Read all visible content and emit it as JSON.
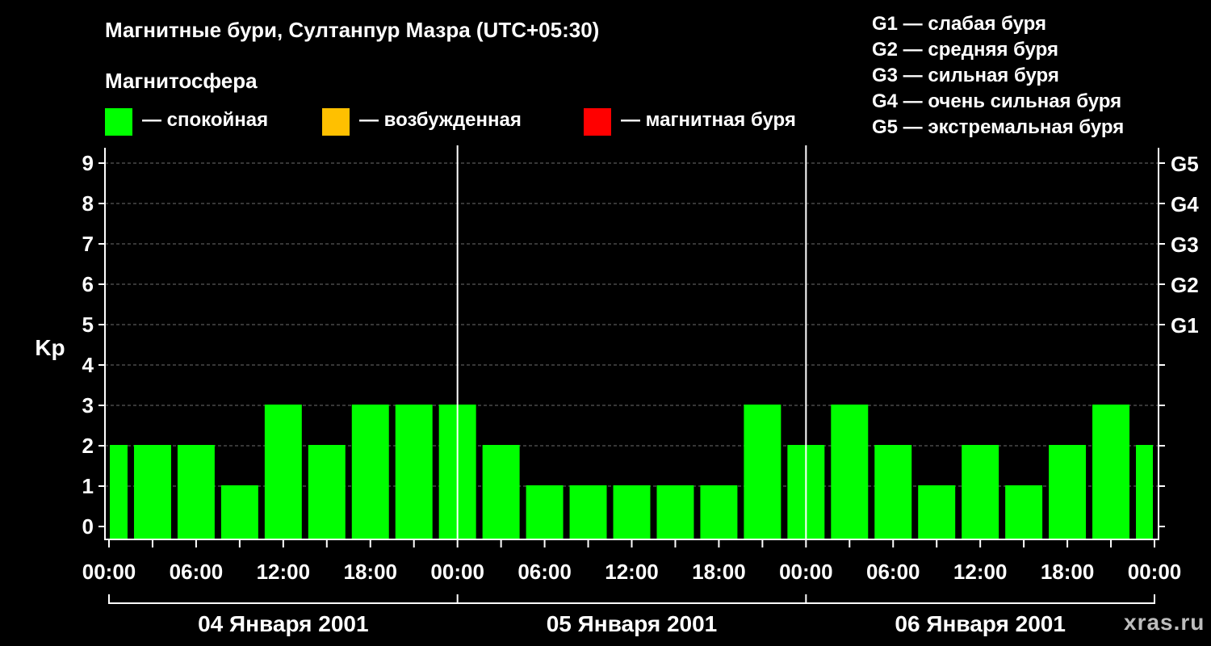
{
  "title": "Магнитные бури, Султанпур Мазра (UTC+05:30)",
  "legend": {
    "title": "Магнитосфера",
    "items": [
      {
        "label": "— спокойная",
        "color": "#00ff00"
      },
      {
        "label": "— возбужденная",
        "color": "#ffc000"
      },
      {
        "label": "— магнитная буря",
        "color": "#ff0000"
      }
    ]
  },
  "g_scale": [
    "G1 — слабая буря",
    "G2 — средняя буря",
    "G3 — сильная буря",
    "G4 — очень сильная буря",
    "G5 — экстремальная буря"
  ],
  "watermark": "xras.ru",
  "chart_data": {
    "type": "bar",
    "ylabel": "Kp",
    "ylim": [
      0,
      9
    ],
    "y_ticks": [
      0,
      1,
      2,
      3,
      4,
      5,
      6,
      7,
      8,
      9
    ],
    "right_axis_labels": [
      {
        "value": 5,
        "label": "G1"
      },
      {
        "value": 6,
        "label": "G2"
      },
      {
        "value": 7,
        "label": "G3"
      },
      {
        "value": 8,
        "label": "G4"
      },
      {
        "value": 9,
        "label": "G5"
      }
    ],
    "x_tick_labels": [
      "00:00",
      "06:00",
      "12:00",
      "18:00",
      "00:00",
      "06:00",
      "12:00",
      "18:00",
      "00:00",
      "06:00",
      "12:00",
      "18:00",
      "00:00"
    ],
    "days": [
      "04 Января 2001",
      "05 Января 2001",
      "06 Января 2001"
    ],
    "x_range_hours": [
      0,
      72
    ],
    "grid": true,
    "bars": [
      {
        "start_hour": 0,
        "end_hour": 1.5,
        "kp": 2,
        "level": "quiet"
      },
      {
        "start_hour": 1.5,
        "end_hour": 4.5,
        "kp": 2,
        "level": "quiet"
      },
      {
        "start_hour": 4.5,
        "end_hour": 7.5,
        "kp": 2,
        "level": "quiet"
      },
      {
        "start_hour": 7.5,
        "end_hour": 10.5,
        "kp": 1,
        "level": "quiet"
      },
      {
        "start_hour": 10.5,
        "end_hour": 13.5,
        "kp": 3,
        "level": "quiet"
      },
      {
        "start_hour": 13.5,
        "end_hour": 16.5,
        "kp": 2,
        "level": "quiet"
      },
      {
        "start_hour": 16.5,
        "end_hour": 19.5,
        "kp": 3,
        "level": "quiet"
      },
      {
        "start_hour": 19.5,
        "end_hour": 22.5,
        "kp": 3,
        "level": "quiet"
      },
      {
        "start_hour": 22.5,
        "end_hour": 25.5,
        "kp": 3,
        "level": "quiet"
      },
      {
        "start_hour": 25.5,
        "end_hour": 28.5,
        "kp": 2,
        "level": "quiet"
      },
      {
        "start_hour": 28.5,
        "end_hour": 31.5,
        "kp": 1,
        "level": "quiet"
      },
      {
        "start_hour": 31.5,
        "end_hour": 34.5,
        "kp": 1,
        "level": "quiet"
      },
      {
        "start_hour": 34.5,
        "end_hour": 37.5,
        "kp": 1,
        "level": "quiet"
      },
      {
        "start_hour": 37.5,
        "end_hour": 40.5,
        "kp": 1,
        "level": "quiet"
      },
      {
        "start_hour": 40.5,
        "end_hour": 43.5,
        "kp": 1,
        "level": "quiet"
      },
      {
        "start_hour": 43.5,
        "end_hour": 46.5,
        "kp": 3,
        "level": "quiet"
      },
      {
        "start_hour": 46.5,
        "end_hour": 49.5,
        "kp": 2,
        "level": "quiet"
      },
      {
        "start_hour": 49.5,
        "end_hour": 52.5,
        "kp": 3,
        "level": "quiet"
      },
      {
        "start_hour": 52.5,
        "end_hour": 55.5,
        "kp": 2,
        "level": "quiet"
      },
      {
        "start_hour": 55.5,
        "end_hour": 58.5,
        "kp": 1,
        "level": "quiet"
      },
      {
        "start_hour": 58.5,
        "end_hour": 61.5,
        "kp": 2,
        "level": "quiet"
      },
      {
        "start_hour": 61.5,
        "end_hour": 64.5,
        "kp": 1,
        "level": "quiet"
      },
      {
        "start_hour": 64.5,
        "end_hour": 67.5,
        "kp": 2,
        "level": "quiet"
      },
      {
        "start_hour": 67.5,
        "end_hour": 70.5,
        "kp": 3,
        "level": "quiet"
      },
      {
        "start_hour": 70.5,
        "end_hour": 72,
        "kp": 2,
        "level": "quiet"
      }
    ],
    "level_colors": {
      "quiet": "#00ff00",
      "active": "#ffc000",
      "storm": "#ff0000"
    }
  }
}
